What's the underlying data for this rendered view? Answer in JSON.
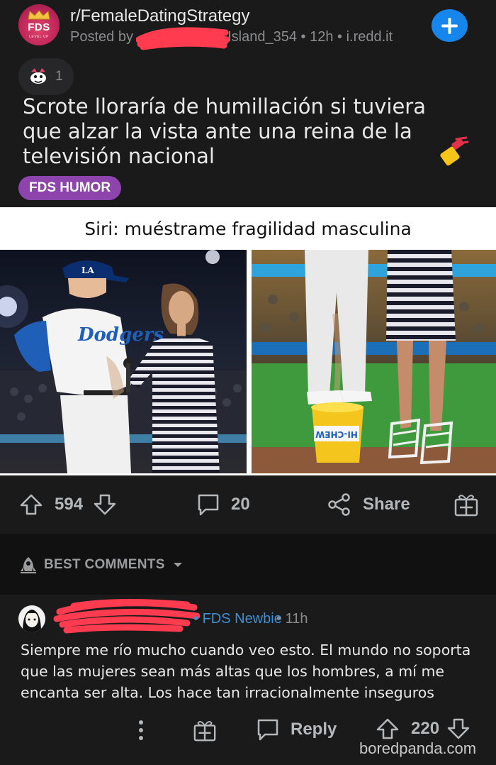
{
  "post": {
    "subreddit": "r/FemaleDatingStrategy",
    "posted_by_prefix": "Posted by",
    "username_visible": "l_Island_354",
    "age": "12h",
    "domain": "i.redd.it",
    "award_count": "1",
    "title": "Scrote lloraría de humillación si tuviera que alzar la vista ante una reina de la televisión nacional",
    "flair": "FDS HUMOR",
    "avatar_text": "FDS",
    "avatar_subtext": "LEVEL UP"
  },
  "meme": {
    "caption": "Siri: muéstrame fragilidad masculina",
    "jersey_text": "Dodgers",
    "cap_letters": "LA",
    "bucket_text": "HI-CHEW"
  },
  "actions": {
    "upvotes": "594",
    "comments": "20",
    "share_label": "Share"
  },
  "comments_section": {
    "sort_label": "BEST COMMENTS"
  },
  "comment": {
    "flair": "FDS Newbie",
    "age": "11h",
    "body": "Siempre me río mucho cuando veo esto. El mundo no soporta que las mujeres sean más altas que los hombres, a mí me encanta ser alta. Los hace tan irracionalmente inseguros",
    "reply_label": "Reply",
    "votes": "220"
  },
  "watermark": "boredpanda.com",
  "colors": {
    "background": "#1a1a1b",
    "accent_blue": "#1686ec",
    "flair_purple": "#8e44ad",
    "scribble_red": "#ff3b4f",
    "user_flair_blue": "#3d8fd6"
  }
}
